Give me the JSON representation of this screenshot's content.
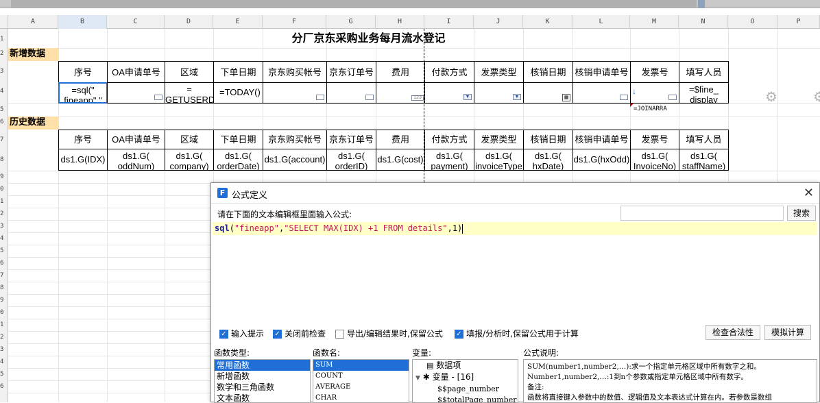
{
  "columns": [
    "A",
    "B",
    "C",
    "D",
    "E",
    "F",
    "G",
    "H",
    "I",
    "J",
    "K",
    "L",
    "M",
    "N",
    "O",
    "P"
  ],
  "rows": [
    "1",
    "2",
    "3",
    "4",
    "5",
    "6",
    "7",
    "8",
    "9",
    "0",
    "1",
    "2",
    "3",
    "4",
    "5",
    "6",
    "7",
    "8",
    "9",
    "0",
    "1",
    "2",
    "3",
    "4",
    "5",
    "6"
  ],
  "sheet": {
    "title": "分厂京东采购业务每月流水登记",
    "section_new": "新增数据",
    "section_history": "历史数据",
    "headers": [
      "序号",
      "OA申请单号",
      "区域",
      "下单日期",
      "京东购买帐号",
      "京东订单号",
      "费用",
      "付款方式",
      "发票类型",
      "核销日期",
      "核销申请单号",
      "发票号",
      "填写人员"
    ],
    "new_row": [
      "=sql(\" fineapp\",\"",
      "",
      "= GETUSERD",
      "=TODAY()",
      "",
      "",
      "",
      "",
      "",
      "",
      "",
      "",
      "=$fine_ display"
    ],
    "below_invoice": "=JOINARRA",
    "history_row": [
      "ds1.G(IDX)",
      "ds1.G( oddNum)",
      "ds1.G( company)",
      "ds1.G( orderDate)",
      "ds1.G(account)",
      "ds1.G( orderID)",
      "ds1.G(cost)",
      "ds1.G( payment)",
      "ds1.G( invoiceType",
      "ds1.G( hxDate)",
      "ds1.G(hxOdd)",
      "ds1.G( InvoiceNo)",
      "ds1.G( staffName)"
    ],
    "number_widget": "123"
  },
  "dialog": {
    "title": "公式定义",
    "prompt": "请在下面的文本编辑框里面输入公式:",
    "search_placeholder": "",
    "search_label": "搜索",
    "formula": {
      "fn": "sql",
      "open": "(",
      "arg1": "\"fineapp\"",
      "comma1": ",",
      "arg2": "\"SELECT MAX(IDX) +1 FROM details\"",
      "rest": ",1)"
    },
    "checkboxes": [
      {
        "label": "输入提示",
        "checked": true
      },
      {
        "label": "关闭前检查",
        "checked": true
      },
      {
        "label": "导出/编辑结果时,保留公式",
        "checked": false
      },
      {
        "label": "填报/分析时,保留公式用于计算",
        "checked": true
      }
    ],
    "check_validity_label": "检查合法性",
    "simulate_label": "模拟计算",
    "func_type_label": "函数类型:",
    "func_types": [
      "常用函数",
      "新增函数",
      "数学和三角函数",
      "文本函数"
    ],
    "func_name_label": "函数名:",
    "func_names": [
      "SUM",
      "COUNT",
      "AVERAGE",
      "CHAR"
    ],
    "var_label": "变量:",
    "vars": {
      "dataset": "数据项",
      "variables": "变量 - [16]",
      "items": [
        "$$page_number",
        "$$totalPage_number"
      ]
    },
    "desc_label": "公式说明:",
    "desc_lines": [
      "SUM(number1,number2,…):求一个指定单元格区域中所有数字之和。",
      "Number1,number2,…:1到n个参数或指定单元格区域中所有数字。",
      "备注:",
      "函数将直接键入参数中的数值、逻辑值及文本表达式计算在内。若参数是数组"
    ]
  }
}
